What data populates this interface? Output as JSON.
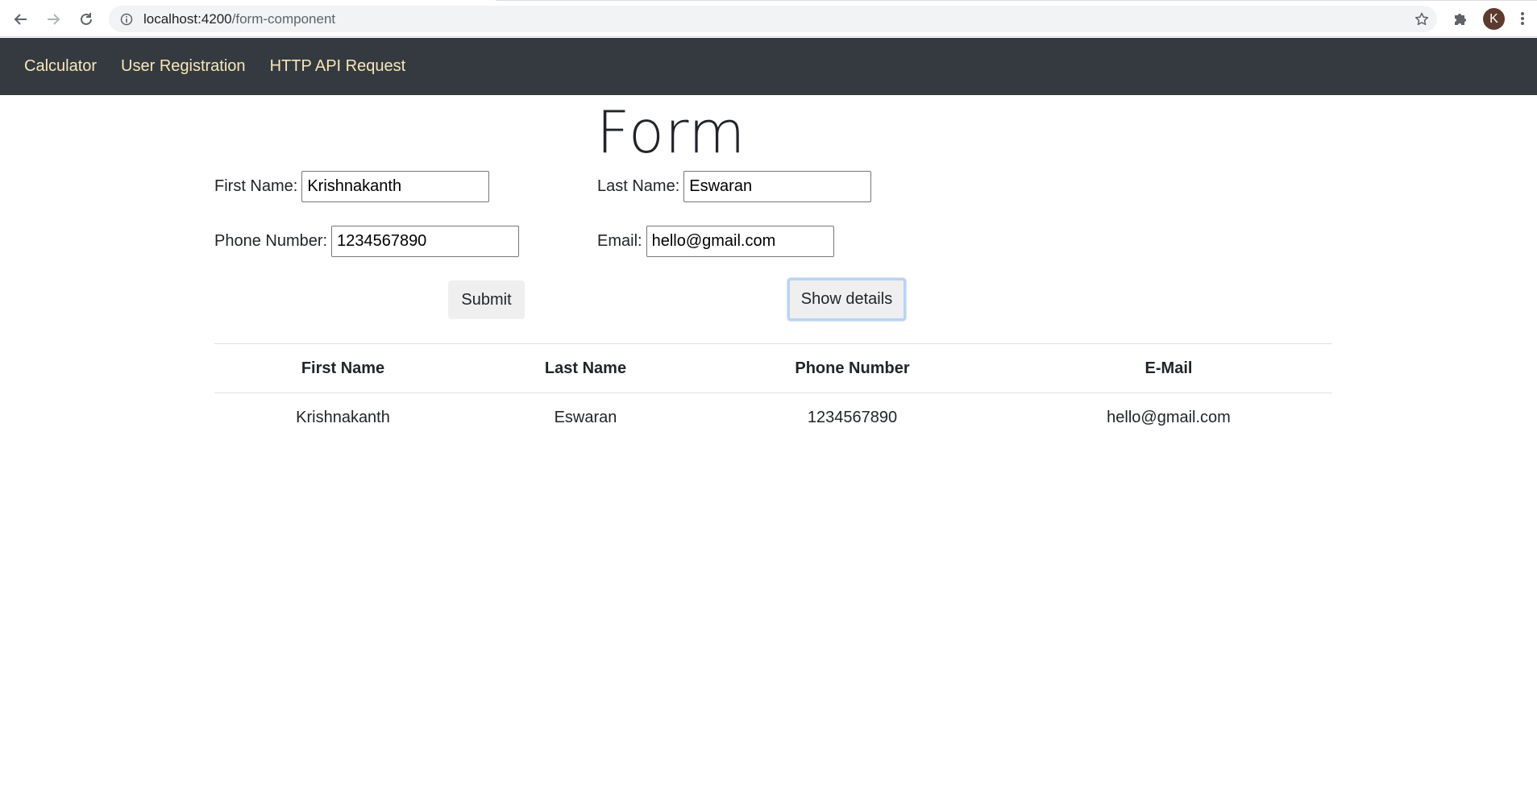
{
  "browser": {
    "url_host": "localhost:4200",
    "url_path": "/form-component",
    "profile_initial": "K"
  },
  "navbar": {
    "items": [
      {
        "label": "Calculator"
      },
      {
        "label": "User Registration"
      },
      {
        "label": "HTTP API Request"
      }
    ]
  },
  "form": {
    "title": "Form",
    "first_name": {
      "label": "First Name:",
      "value": "Krishnakanth"
    },
    "last_name": {
      "label": "Last Name:",
      "value": "Eswaran"
    },
    "phone": {
      "label": "Phone Number:",
      "value": "1234567890"
    },
    "email": {
      "label": "Email:",
      "value": "hello@gmail.com"
    },
    "submit_label": "Submit",
    "show_details_label": "Show details"
  },
  "table": {
    "headers": [
      "First Name",
      "Last Name",
      "Phone Number",
      "E-Mail"
    ],
    "rows": [
      [
        "Krishnakanth",
        "Eswaran",
        "1234567890",
        "hello@gmail.com"
      ]
    ]
  },
  "colors": {
    "navbar_bg": "#343a40",
    "navbar_link": "#f8e7b8",
    "avatar_bg": "#5d3a2e"
  }
}
